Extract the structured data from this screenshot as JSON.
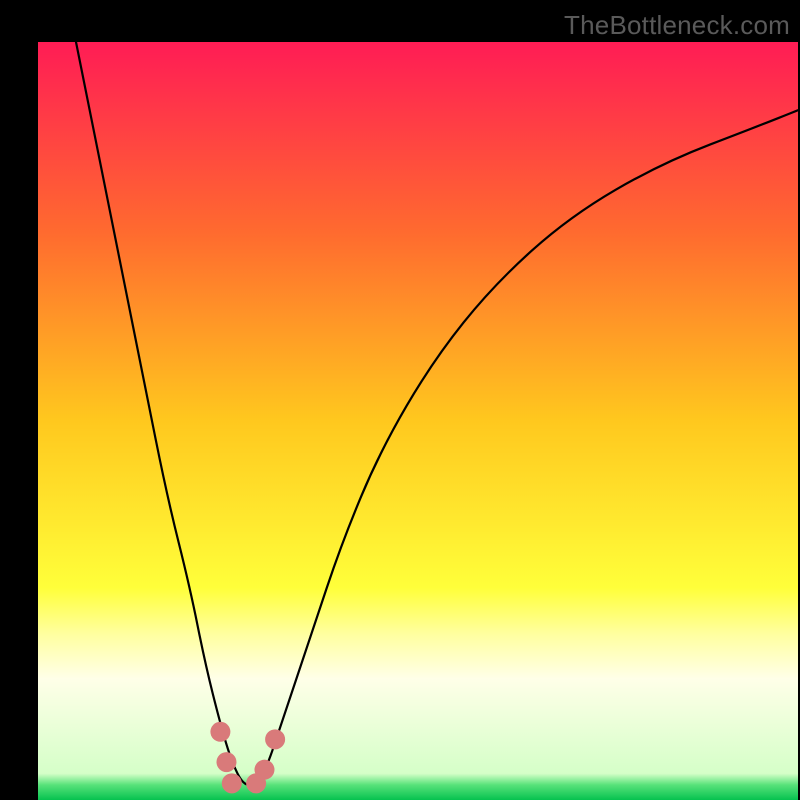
{
  "watermark": "TheBottleneck.com",
  "chart_data": {
    "type": "line",
    "title": "",
    "xlabel": "",
    "ylabel": "",
    "xlim": [
      0,
      100
    ],
    "ylim": [
      0,
      100
    ],
    "grid": false,
    "legend": false,
    "gradient_stops": [
      {
        "offset": 0.0,
        "color": "#ff1c55"
      },
      {
        "offset": 0.25,
        "color": "#ff6a2f"
      },
      {
        "offset": 0.5,
        "color": "#ffc81e"
      },
      {
        "offset": 0.72,
        "color": "#ffff3a"
      },
      {
        "offset": 0.78,
        "color": "#ffff9e"
      },
      {
        "offset": 0.84,
        "color": "#ffffe8"
      },
      {
        "offset": 0.965,
        "color": "#d5ffc8"
      },
      {
        "offset": 0.98,
        "color": "#58e27a"
      },
      {
        "offset": 1.0,
        "color": "#06c24f"
      }
    ],
    "series": [
      {
        "name": "bottleneck-curve",
        "x": [
          5,
          8,
          11,
          14,
          17,
          20,
          22,
          24,
          25.5,
          27,
          28.5,
          30,
          32,
          36,
          40,
          45,
          52,
          60,
          70,
          82,
          95,
          100
        ],
        "y": [
          100,
          85,
          70,
          55,
          40,
          28,
          18,
          10,
          5,
          2,
          2,
          4,
          10,
          22,
          34,
          46,
          58,
          68,
          77,
          84,
          89,
          91
        ]
      }
    ],
    "highlight_points": {
      "color": "#d97a7a",
      "radius_px": 10,
      "points": [
        {
          "x": 24.0,
          "y": 9.0
        },
        {
          "x": 24.8,
          "y": 5.0
        },
        {
          "x": 25.5,
          "y": 2.2
        },
        {
          "x": 28.7,
          "y": 2.2
        },
        {
          "x": 29.8,
          "y": 4.0
        },
        {
          "x": 31.2,
          "y": 8.0
        }
      ]
    }
  }
}
